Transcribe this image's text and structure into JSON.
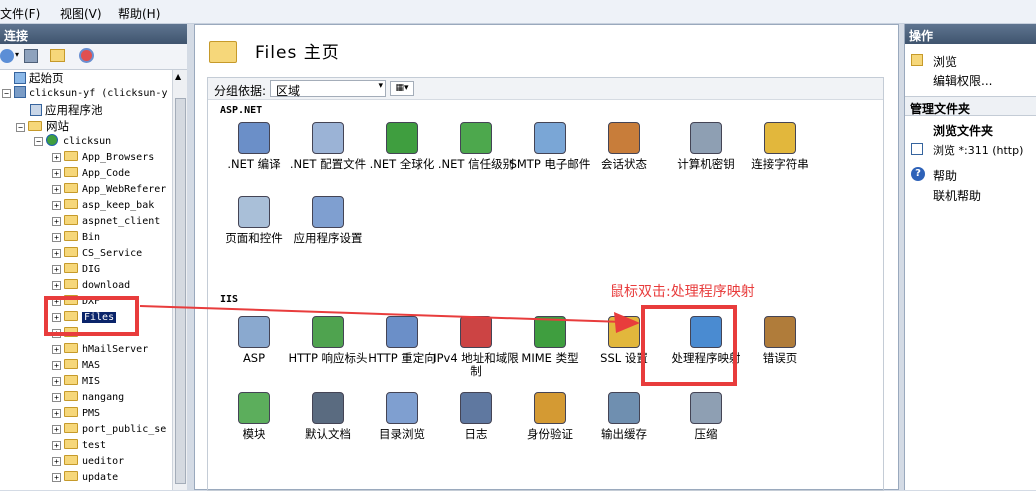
{
  "menu": {
    "file": "文件(F)",
    "view": "视图(V)",
    "help": "帮助(H)"
  },
  "left": {
    "title": "连接"
  },
  "tree": {
    "start": "起始页",
    "server": "clicksun-yf (clicksun-y",
    "apppools": "应用程序池",
    "sites": "网站",
    "site": "clicksun",
    "folders": [
      "App_Browsers",
      "App_Code",
      "App_WebReferer",
      "asp_keep_bak",
      "aspnet_client",
      "Bin",
      "CS_Service",
      "DIG",
      "download",
      "DXF",
      "Files",
      "",
      "hMailServer",
      "MAS",
      "MIS",
      "nangang",
      "PMS",
      "port_public_se",
      "test",
      "ueditor",
      "update"
    ]
  },
  "center": {
    "title": "Files 主页",
    "groupby_label": "分组依据:",
    "groupby_value": "区域",
    "section_asp": "ASP.NET",
    "section_iis": "IIS",
    "aspnet_items": [
      ".NET 编译",
      ".NET 配置文件",
      ".NET 全球化",
      ".NET 信任级别",
      "SMTP 电子邮件",
      "会话状态",
      "计算机密钥",
      "连接字符串",
      "页面和控件",
      "应用程序设置"
    ],
    "iis_items": [
      "ASP",
      "HTTP 响应标头",
      "HTTP 重定向",
      "IPv4 地址和域限制",
      "MIME 类型",
      "SSL 设置",
      "处理程序映射",
      "错误页",
      "模块",
      "默认文档",
      "目录浏览",
      "日志",
      "身份验证",
      "输出缓存",
      "压缩"
    ],
    "annotation": "鼠标双击:处理程序映射"
  },
  "right": {
    "title": "操作",
    "browse": "浏览",
    "edit_perm": "编辑权限...",
    "manage": "管理文件夹",
    "browse_folder": "浏览文件夹",
    "browse_http": "浏览 *:311 (http)",
    "help": "帮助",
    "online_help": "联机帮助"
  },
  "colors": {
    "annotation": "#e83c3c",
    "title_bar": "#4a6078"
  }
}
